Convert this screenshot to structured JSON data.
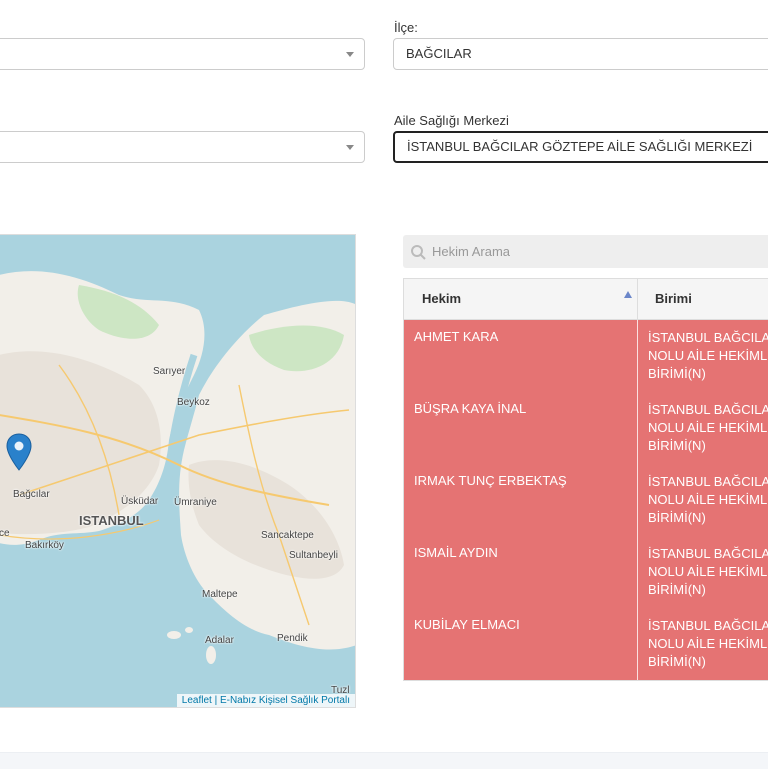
{
  "filters": {
    "ilce_label": "İlçe:",
    "ilce_value": "BAĞCILAR",
    "asm_label": "Aile Sağlığı Merkezi",
    "asm_value": "İSTANBUL BAĞCILAR GÖZTEPE AİLE SAĞLIĞI MERKEZİ",
    "left_select_1_value": "",
    "left_select_2_value": ""
  },
  "map": {
    "labels": {
      "sariyer": "Sarıyer",
      "beykoz": "Beykoz",
      "bagcilar": "Bağcılar",
      "uskudar": "Üsküdar",
      "umraniye": "Ümraniye",
      "istanbul": "ISTANBUL",
      "bakirkoy": "Bakırköy",
      "sancaktepe": "Sancaktepe",
      "sultanbeyli": "Sultanbeyli",
      "maltepe": "Maltepe",
      "adalar": "Adalar",
      "pendik": "Pendik",
      "partial_ce": "ce",
      "partial_tuzla": "Tuzl"
    },
    "attribution": "Leaflet | E-Nabız Kişisel Sağlık Portalı",
    "marker_color": "#2a81cb"
  },
  "search": {
    "placeholder": "Hekim Arama"
  },
  "table": {
    "headers": {
      "hekim": "Hekim",
      "birimi": "Birimi"
    },
    "row_color": "#e57373",
    "rows": [
      {
        "name": "AHMET KARA",
        "unit_l1": "İSTANBUL BAĞCILAR",
        "unit_l2": "NOLU AİLE HEKİMLİĞİ",
        "unit_l3": "BİRİMİ(N)"
      },
      {
        "name": "BÜŞRA KAYA İNAL",
        "unit_l1": "İSTANBUL BAĞCILAR",
        "unit_l2": "NOLU AİLE HEKİMLİĞİ",
        "unit_l3": "BİRİMİ(N)"
      },
      {
        "name": "IRMAK TUNÇ ERBEKTAŞ",
        "unit_l1": "İSTANBUL BAĞCILAR",
        "unit_l2": "NOLU AİLE HEKİMLİĞİ",
        "unit_l3": "BİRİMİ(N)"
      },
      {
        "name": "ISMAİL AYDIN",
        "unit_l1": "İSTANBUL BAĞCILAR",
        "unit_l2": "NOLU AİLE HEKİMLİĞİ",
        "unit_l3": "BİRİMİ(N)"
      },
      {
        "name": "KUBİLAY ELMACI",
        "unit_l1": "İSTANBUL BAĞCILAR",
        "unit_l2": "NOLU AİLE HEKİMLİĞİ",
        "unit_l3": "BİRİMİ(N)"
      }
    ]
  }
}
